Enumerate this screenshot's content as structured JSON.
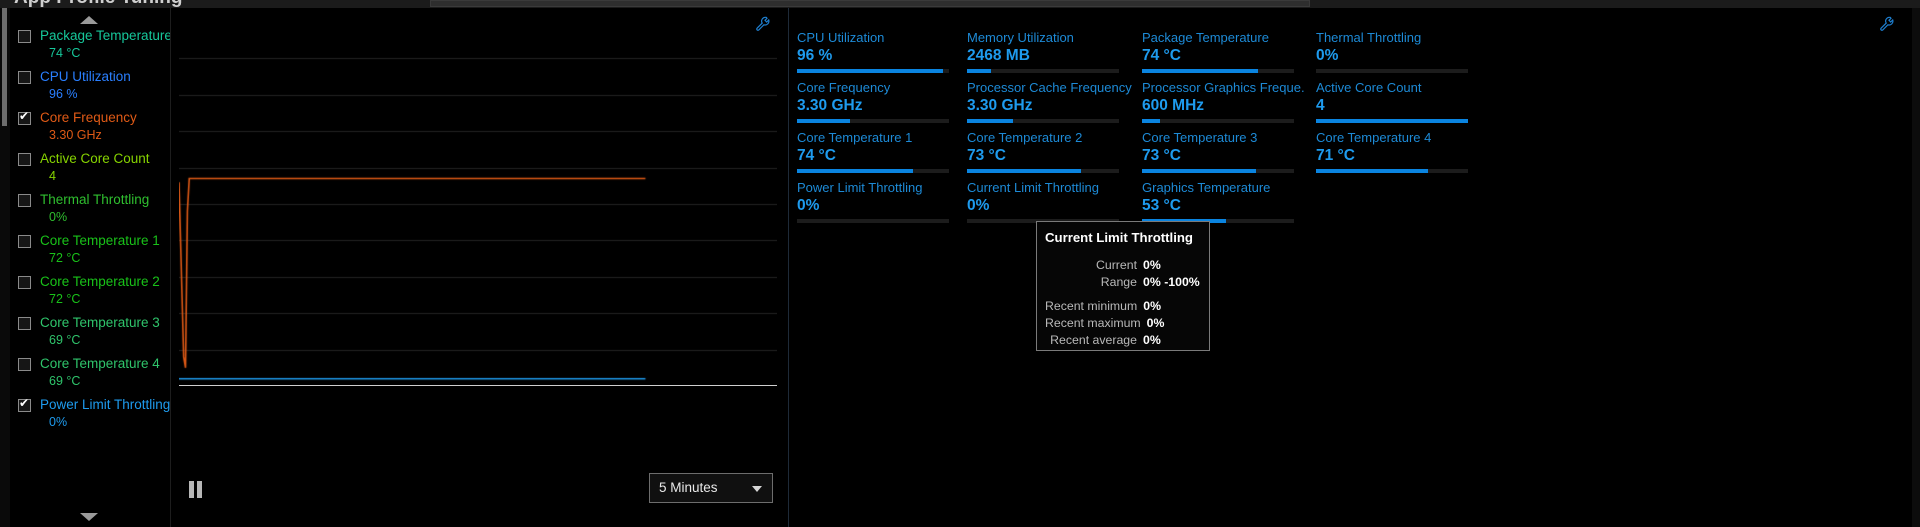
{
  "window": {
    "title": "App Profile Tuning",
    "buttons": [
      "minimize",
      "maximize",
      "close"
    ]
  },
  "sidebar": {
    "scroll_up_icon": "chevron-up-icon",
    "scroll_down_icon": "chevron-down-icon",
    "items": [
      {
        "label": "Package Temperature",
        "value": "74 °C",
        "checked": false,
        "color": "#16c79a"
      },
      {
        "label": "CPU Utilization",
        "value": "96 %",
        "checked": false,
        "color": "#2a7fff"
      },
      {
        "label": "Core Frequency",
        "value": "3.30 GHz",
        "checked": true,
        "color": "#e05a16"
      },
      {
        "label": "Active Core Count",
        "value": "4",
        "checked": false,
        "color": "#86d300"
      },
      {
        "label": "Thermal Throttling",
        "value": "0%",
        "checked": false,
        "color": "#2fbf2f"
      },
      {
        "label": "Core Temperature 1",
        "value": "72 °C",
        "checked": false,
        "color": "#19c219"
      },
      {
        "label": "Core Temperature 2",
        "value": "72 °C",
        "checked": false,
        "color": "#19c219"
      },
      {
        "label": "Core Temperature 3",
        "value": "69 °C",
        "checked": false,
        "color": "#2fc46b"
      },
      {
        "label": "Core Temperature 4",
        "value": "69 °C",
        "checked": false,
        "color": "#2fc46b"
      },
      {
        "label": "Power Limit Throttling",
        "value": "0%",
        "checked": true,
        "color": "#1e9bee"
      }
    ]
  },
  "chart": {
    "settings_icon": "wrench-icon",
    "pause_icon": "pause-icon",
    "range_value": "5 Minutes",
    "dropdown_icon": "chevron-down-icon"
  },
  "chart_data": {
    "type": "line",
    "title": "",
    "xlabel": "",
    "ylabel": "",
    "grid": true,
    "legend": "sidebar",
    "series": [
      {
        "name": "Core Frequency",
        "color": "#e05a16",
        "points": [
          [
            0,
            56
          ],
          [
            1.0,
            8
          ],
          [
            1.4,
            5
          ],
          [
            1.8,
            48
          ],
          [
            2.2,
            57
          ],
          [
            100,
            57
          ]
        ]
      },
      {
        "name": "Power Limit Throttling",
        "color": "#1e9bee",
        "points": [
          [
            0,
            2
          ],
          [
            100,
            2
          ]
        ]
      }
    ]
  },
  "cards": {
    "settings_icon": "wrench-icon",
    "columns": [
      {
        "items": [
          {
            "label": "CPU Utilization",
            "value": "96 %",
            "fill": 96
          },
          {
            "label": "Core Frequency",
            "value": "3.30 GHz",
            "fill": 35
          },
          {
            "label": "Core Temperature 1",
            "value": "74 °C",
            "fill": 76
          },
          {
            "label": "Power Limit Throttling",
            "value": "0%",
            "fill": 0
          }
        ]
      },
      {
        "items": [
          {
            "label": "Memory Utilization",
            "value": "2468  MB",
            "fill": 16
          },
          {
            "label": "Processor Cache Frequency",
            "value": "3.30 GHz",
            "fill": 30
          },
          {
            "label": "Core Temperature 2",
            "value": "73 °C",
            "fill": 75
          },
          {
            "label": "Current Limit Throttling",
            "value": "0%",
            "fill": 0
          }
        ]
      },
      {
        "items": [
          {
            "label": "Package Temperature",
            "value": "74 °C",
            "fill": 76
          },
          {
            "label": "Processor Graphics Freque...",
            "value": "600 MHz",
            "fill": 12
          },
          {
            "label": "Core Temperature 3",
            "value": "73 °C",
            "fill": 75
          },
          {
            "label": "Graphics Temperature",
            "value": "53 °C",
            "fill": 55
          }
        ]
      },
      {
        "items": [
          {
            "label": "Thermal Throttling",
            "value": "0%",
            "fill": 0
          },
          {
            "label": "Active Core Count",
            "value": "4",
            "fill": 100
          },
          {
            "label": "Core Temperature 4",
            "value": "71 °C",
            "fill": 74
          }
        ]
      }
    ]
  },
  "tooltip": {
    "title": "Current Limit Throttling",
    "rows": [
      {
        "key": "Current",
        "value": "0%"
      },
      {
        "key": "Range",
        "value": "0% -100%"
      }
    ],
    "rows2": [
      {
        "key": "Recent minimum",
        "value": "0%"
      },
      {
        "key": "Recent maximum",
        "value": "0%"
      },
      {
        "key": "Recent average",
        "value": "0%"
      }
    ]
  },
  "theme": {
    "accent": "#0a84e0",
    "label_blue": "#1d8ad6",
    "value_blue": "#1e9bee",
    "background": "#000000"
  }
}
